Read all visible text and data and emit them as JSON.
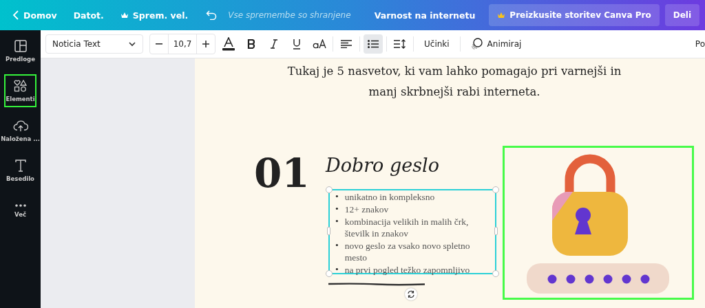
{
  "top_bar": {
    "back": "Domov",
    "file_menu": "Datot.",
    "resize": "Sprem. vel.",
    "save_status": "Vse spremembe so shranjene",
    "title": "Varnost na internetu",
    "pro_button": "Preizkusite storitev Canva Pro",
    "share_button": "Deli"
  },
  "sidebar": {
    "items": [
      {
        "kind": "templates",
        "label": "Predloge",
        "highlighted": false
      },
      {
        "kind": "elements",
        "label": "Elementi",
        "highlighted": true
      },
      {
        "kind": "uploads",
        "label": "Naložena ...",
        "highlighted": false
      },
      {
        "kind": "text",
        "label": "Besedilo",
        "highlighted": false
      },
      {
        "kind": "more",
        "label": "Več",
        "highlighted": false
      }
    ]
  },
  "toolbar": {
    "font": "Noticia Text",
    "font_size": "10,7",
    "list_selected": true,
    "effects": "Učinki",
    "animate": "Animiraj",
    "position": "Po"
  },
  "canvas": {
    "intro_lines": [
      "Tukaj je 5 nasvetov, ki vam lahko pomagajo pri varnejši in",
      "manj skrbnejši rabi interneta."
    ],
    "number": "01",
    "bullet_mark": "•",
    "heading": "Dobro geslo",
    "bullets": [
      "unikatno in kompleksno",
      "12+ znakov",
      "kombinacija velikih in malih črk, številk in znakov",
      "novo geslo za vsako novo spletno mesto",
      "na prvi pogled težko zapomnljivo"
    ],
    "illustration": {
      "highlighted": true
    }
  }
}
